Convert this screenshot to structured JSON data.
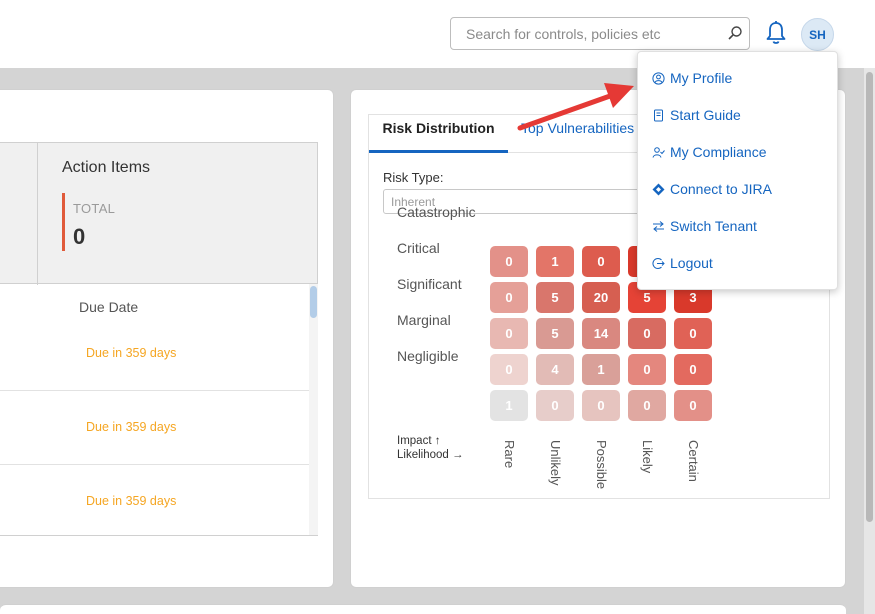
{
  "header": {
    "search_placeholder": "Search for controls, policies etc",
    "search_icon": "search-icon",
    "bell_icon": "bell-icon",
    "avatar_initials": "SH"
  },
  "action_items": {
    "title": "Action Items",
    "total_label": "TOTAL",
    "total_value": "0",
    "accent_color": "#e05a3a"
  },
  "table": {
    "due_header": "Due Date",
    "rows": [
      {
        "due": "Due in 359 days"
      },
      {
        "due": "Due in 359 days"
      },
      {
        "due": "Due in 359 days"
      }
    ],
    "due_color": "#f5a623"
  },
  "risk": {
    "tabs": [
      {
        "label": "Risk Distribution",
        "active": true
      },
      {
        "label": "Top Vulnerabilities",
        "active": false
      }
    ],
    "risk_type_label": "Risk Type:",
    "risk_type_value": "Inherent",
    "impact_axis": "Impact ↑",
    "likelihood_axis": "Likelihood →",
    "row_labels": [
      "Catastrophic",
      "Critical",
      "Significant",
      "Marginal",
      "Negligible"
    ],
    "col_labels": [
      "Rare",
      "Unlikely",
      "Possible",
      "Likely",
      "Certain"
    ],
    "matrix": [
      [
        "0",
        "1",
        "0",
        "",
        ""
      ],
      [
        "0",
        "5",
        "20",
        "5",
        "3"
      ],
      [
        "0",
        "5",
        "14",
        "0",
        "0"
      ],
      [
        "0",
        "4",
        "1",
        "0",
        "0"
      ],
      [
        "1",
        "0",
        "0",
        "0",
        "0"
      ]
    ],
    "matrix_colors": [
      [
        "#e39189",
        "#e37568",
        "#dd5c4e",
        "#d9392b",
        "#d53224"
      ],
      [
        "#e5a098",
        "#d9766c",
        "#d65f51",
        "#e54336",
        "#d9392b"
      ],
      [
        "#e8b8b2",
        "#d99a93",
        "#d98880",
        "#d86b61",
        "#e06256"
      ],
      [
        "#eed3cf",
        "#e2bbb6",
        "#d9a099",
        "#e4877e",
        "#e36a5f"
      ],
      [
        "#e3e3e3",
        "#e7cdca",
        "#e6c4bf",
        "#e0a8a1",
        "#e39088"
      ]
    ]
  },
  "user_menu": {
    "items": [
      {
        "label": "My Profile",
        "icon": "user-circle-icon"
      },
      {
        "label": "Start Guide",
        "icon": "book-icon"
      },
      {
        "label": "My Compliance",
        "icon": "user-check-icon"
      },
      {
        "label": "Connect to JIRA",
        "icon": "jira-icon"
      },
      {
        "label": "Switch Tenant",
        "icon": "swap-icon"
      },
      {
        "label": "Logout",
        "icon": "logout-icon"
      }
    ],
    "accent_color": "#1565c0"
  },
  "annotation": {
    "arrow_color": "#e53935"
  }
}
